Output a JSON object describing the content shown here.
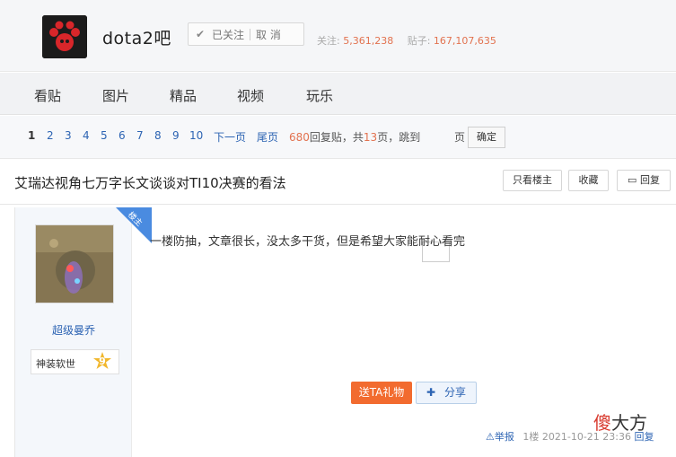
{
  "forum": {
    "name": "dota2吧",
    "follow_label": "已关注",
    "cancel_label": "取 消",
    "followers_label": "关注:",
    "followers_value": "5,361,238",
    "posts_label": "贴子:",
    "posts_value": "167,107,635"
  },
  "nav": {
    "tabs": [
      "看贴",
      "图片",
      "精品",
      "视频",
      "玩乐"
    ]
  },
  "pager": {
    "pages": [
      "1",
      "2",
      "3",
      "4",
      "5",
      "6",
      "7",
      "8",
      "9",
      "10"
    ],
    "next_label": "下一页",
    "last_label": "尾页",
    "reply_count": "680",
    "reply_text": "回复贴，共",
    "page_count": "13",
    "page_text": "页，跳到",
    "page_suffix": "页",
    "confirm_label": "确定"
  },
  "thread": {
    "title": "艾瑞达视角七万字长文谈谈对TI10决赛的看法",
    "only_author_label": "只看楼主",
    "favorite_label": "收藏",
    "reply_label": "回复"
  },
  "post": {
    "corner_label": "楼主",
    "author": "超级曼乔",
    "badge_label": "神装软世",
    "level": "9",
    "content": "一楼防抽，文章很长，没太多干货，但是希望大家能耐心看完",
    "gift_label": "送TA礼物",
    "share_label": "分享",
    "report_label": "举报",
    "floor": "1楼",
    "time": "2021-10-21 23:36",
    "reply_link": "回复"
  },
  "watermark": {
    "part1": "傻",
    "part2": "大方"
  },
  "colors": {
    "accent_orange": "#f26b2f",
    "link_blue": "#2d64b3",
    "count_orange": "#e2724f"
  }
}
